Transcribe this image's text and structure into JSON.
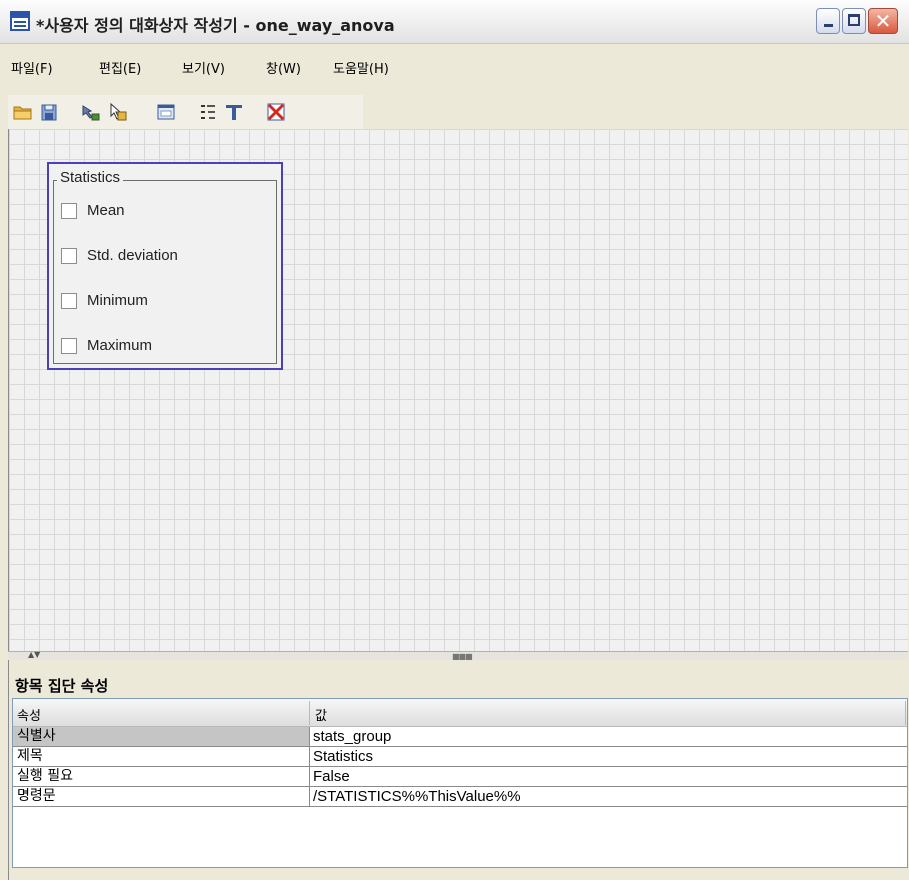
{
  "window": {
    "title": "*사용자 정의 대화상자 작성기 - one_way_anova"
  },
  "menu": {
    "items": [
      {
        "label": "파일(F)"
      },
      {
        "label": "편집(E)"
      },
      {
        "label": "보기(V)"
      },
      {
        "label": "창(W)"
      },
      {
        "label": "도움말(H)"
      }
    ]
  },
  "toolbar": {
    "icons": [
      "open-folder-icon",
      "save-icon",
      "run-icon",
      "syntax-icon",
      "preview-icon",
      "order-icon",
      "tab-icon",
      "delete-icon"
    ]
  },
  "canvas": {
    "group": {
      "title": "Statistics",
      "checkboxes": [
        {
          "label": "Mean",
          "checked": false
        },
        {
          "label": "Std. deviation",
          "checked": false
        },
        {
          "label": "Minimum",
          "checked": false
        },
        {
          "label": "Maximum",
          "checked": false
        }
      ]
    }
  },
  "properties": {
    "title": "항목 집단 속성",
    "header": {
      "property": "속성",
      "value": "값"
    },
    "rows": [
      {
        "key": "식별사",
        "value": "stats_group"
      },
      {
        "key": "제목",
        "value": "Statistics"
      },
      {
        "key": "실행 필요",
        "value": "False"
      },
      {
        "key": "명령문",
        "value": "/STATISTICS%%ThisValue%%"
      }
    ]
  },
  "colors": {
    "selection_border": "#4b40b8",
    "close_button": "#d9593f",
    "app_icon": "#2a55a8"
  }
}
